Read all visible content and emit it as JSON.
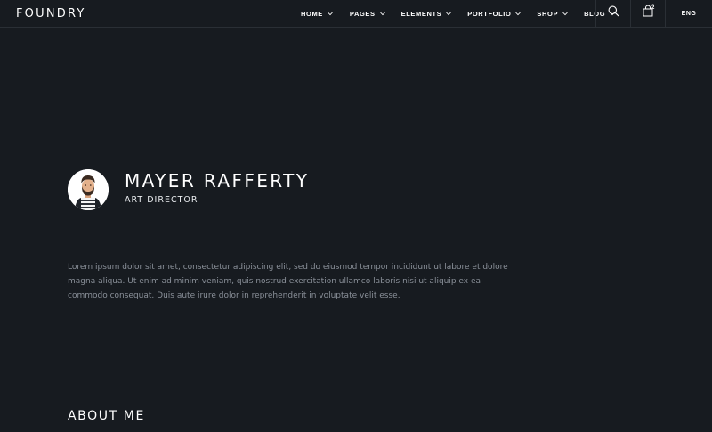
{
  "header": {
    "logo": "FOUNDRY",
    "nav": [
      {
        "label": "HOME"
      },
      {
        "label": "PAGES"
      },
      {
        "label": "ELEMENTS"
      },
      {
        "label": "PORTFOLIO"
      },
      {
        "label": "SHOP"
      },
      {
        "label": "BLOG"
      }
    ],
    "search_icon": "search-icon",
    "cart_icon": "shopping-bag-icon",
    "cart_count": "2",
    "language": "ENG"
  },
  "profile": {
    "name": "MAYER RAFFERTY",
    "role": "ART DIRECTOR",
    "avatar_icon": "avatar-illustration",
    "bio": "Lorem ipsum dolor sit amet, consectetur adipiscing elit, sed do eiusmod tempor incididunt ut labore et dolore magna aliqua. Ut enim ad minim veniam, quis nostrud exercitation ullamco laboris nisi ut aliquip ex ea commodo consequat. Duis aute irure dolor in reprehenderit in voluptate velit esse."
  },
  "sections": {
    "about_title": "ABOUT ME"
  },
  "colors": {
    "background": "#171b20",
    "divider": "#2a2f35",
    "text": "#ffffff",
    "muted_text": "#8a9099"
  }
}
